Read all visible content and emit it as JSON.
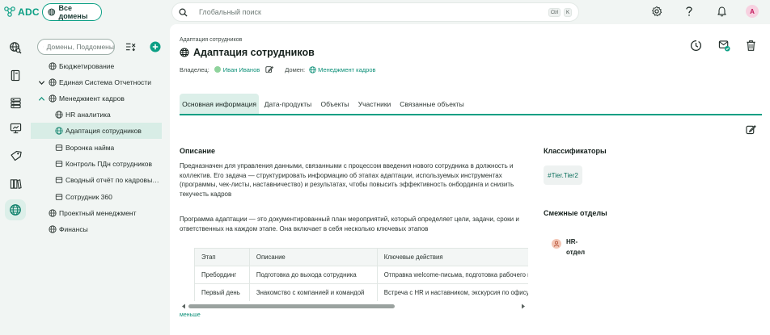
{
  "app": {
    "logo_text": "ADC",
    "all_domains_label": "Все домены"
  },
  "search": {
    "placeholder": "Глобальный поиск",
    "shortcut_ctrl": "Ctrl",
    "shortcut_key": "K"
  },
  "user": {
    "avatar_initial": "A"
  },
  "sidebar": {
    "search_placeholder": "Домены, Поддомены",
    "items": [
      {
        "label": "Бюджетирование",
        "level": 0,
        "expandable": false
      },
      {
        "label": "Единая Система Отчетности",
        "level": 0,
        "expandable": true,
        "expanded": false
      },
      {
        "label": "Менеджмент кадров",
        "level": 0,
        "expandable": true,
        "expanded": true
      },
      {
        "label": "HR аналитика",
        "level": 1,
        "kind": "domain"
      },
      {
        "label": "Адаптация сотрудников",
        "level": 1,
        "kind": "domain",
        "selected": true
      },
      {
        "label": "Воронка найма",
        "level": 1,
        "kind": "product"
      },
      {
        "label": "Контроль ПДн сотрудников",
        "level": 1,
        "kind": "product"
      },
      {
        "label": "Сводный отчёт по кадровым и...",
        "level": 1,
        "kind": "product"
      },
      {
        "label": "Сотрудник 360",
        "level": 1,
        "kind": "product"
      },
      {
        "label": "Проектный менеджмент",
        "level": 0,
        "expandable": false
      },
      {
        "label": "Финансы",
        "level": 0,
        "expandable": false
      }
    ]
  },
  "page": {
    "breadcrumb": "Адаптация сотрудников",
    "title": "Адаптация сотрудников",
    "owner_label": "Владелец:",
    "owner_name": "Иван Иванов",
    "domain_label": "Домен:",
    "domain_name": "Менеджмент кадров"
  },
  "tabs": [
    {
      "label": "Основная информация",
      "active": true
    },
    {
      "label": "Дата-продукты",
      "active": false
    },
    {
      "label": "Объекты",
      "active": false
    },
    {
      "label": "Участники",
      "active": false
    },
    {
      "label": "Связанные объекты",
      "active": false
    }
  ],
  "description": {
    "heading": "Описание",
    "text1": "Предназначен для управления данными, связанными с процессом введения нового сотрудника в должность и коллектив. Его задача — структурировать информацию об этапах адаптации, используемых инструментах (программы, чек-листы, наставничество) и результатах, чтобы повысить эффективность онбординга и снизить текучесть кадров",
    "text2": "Программа адаптации — это документированный план мероприятий, который определяет цели, задачи, сроки и ответственных на каждом этапе. Она включает в себя несколько ключевых этапов",
    "table": {
      "headers": [
        "Этап",
        "Описание",
        "Ключевые действия"
      ],
      "rows": [
        [
          "Пребординг",
          "Подготовка до выхода сотрудника",
          "Отправка welcome-письма, подготовка рабочего места"
        ],
        [
          "Первый день",
          "Знакомство с компанией и командой",
          "Встреча с HR и наставником, экскурсия по офису"
        ]
      ]
    },
    "less_label": "меньше"
  },
  "classifiers": {
    "heading": "Классификаторы",
    "chip": "#Tier.Tier2"
  },
  "related_departments": {
    "heading": "Смежные отделы",
    "items": [
      {
        "label": "HR-отдел"
      }
    ]
  },
  "colors": {
    "accent": "#0b9f84",
    "selected_bg": "#d8ede6",
    "background": "#f1f5f3"
  }
}
